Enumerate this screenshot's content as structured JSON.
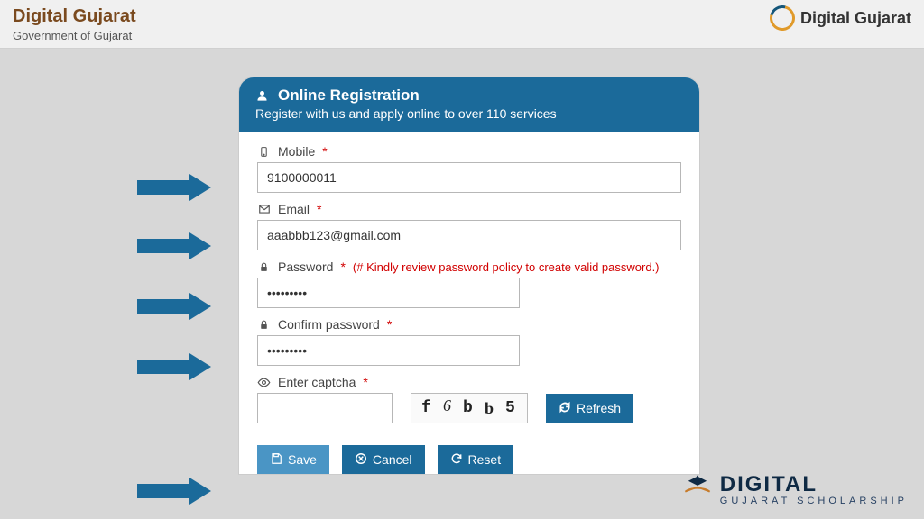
{
  "header": {
    "title": "Digital Gujarat",
    "subtitle": "Government of Gujarat",
    "logo_text": "Digital Gujarat"
  },
  "card": {
    "title": "Online Registration",
    "subtitle": "Register with us and apply online to over 110 services"
  },
  "fields": {
    "mobile": {
      "label": "Mobile",
      "value": "9100000011"
    },
    "email": {
      "label": "Email",
      "value": "aaabbb123@gmail.com"
    },
    "password": {
      "label": "Password",
      "hint": "(# Kindly review password policy to create valid password.)",
      "value": "•••••••••"
    },
    "confirm": {
      "label": "Confirm password",
      "value": "•••••••••"
    },
    "captcha": {
      "label": "Enter captcha",
      "value": "",
      "image_text": "f 6 b b 5"
    }
  },
  "buttons": {
    "refresh": "Refresh",
    "save": "Save",
    "cancel": "Cancel",
    "reset": "Reset"
  },
  "watermark": {
    "line1": "DIGITAL",
    "line2": "GUJARAT SCHOLARSHIP"
  }
}
